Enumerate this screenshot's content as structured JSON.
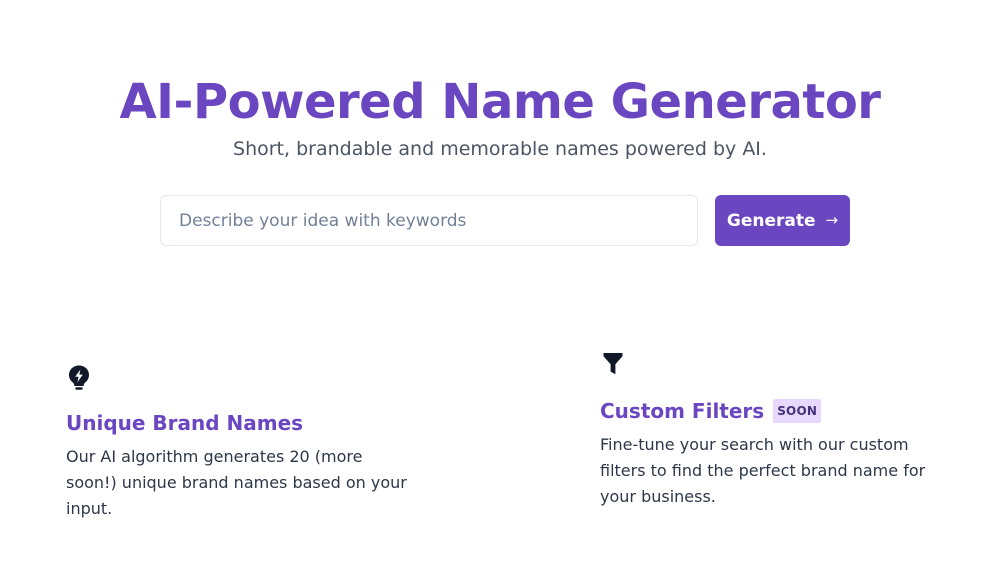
{
  "hero": {
    "title": "AI-Powered Name Generator",
    "subtitle": "Short, brandable and memorable names powered by AI."
  },
  "search": {
    "value": "",
    "placeholder": "Describe your idea with keywords",
    "button_label": "Generate",
    "button_icon": "arrow-right-icon"
  },
  "features": [
    {
      "icon": "lightbulb-icon",
      "title": "Unique Brand Names",
      "badge": "",
      "text": "Our AI algorithm generates 20 (more soon!) unique brand names based on your input."
    },
    {
      "icon": "filter-icon",
      "title": "Custom Filters",
      "badge": "SOON",
      "text": "Fine-tune your search with our custom filters to find the perfect brand name for your business."
    }
  ],
  "colors": {
    "brand": "#6b46c1",
    "badge_bg": "#e9d8fd",
    "subtitle": "#4b5563",
    "body_text": "#2d3748",
    "input_border": "#e2e8f0"
  }
}
